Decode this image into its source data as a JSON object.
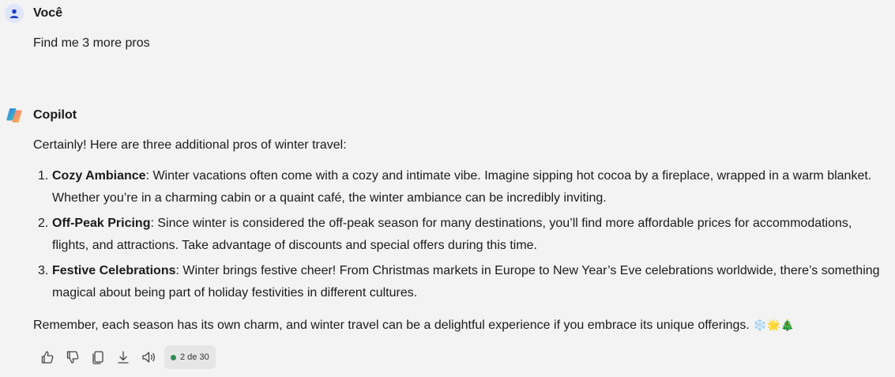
{
  "user_message": {
    "sender": "Você",
    "text": "Find me 3 more pros"
  },
  "copilot_message": {
    "sender": "Copilot",
    "intro": "Certainly! Here are three additional pros of winter travel:",
    "items": [
      {
        "number": "1.",
        "title": "Cozy Ambiance",
        "text": ": Winter vacations often come with a cozy and intimate vibe. Imagine sipping hot cocoa by a fireplace, wrapped in a warm blanket. Whether you’re in a charming cabin or a quaint café, the winter ambiance can be incredibly inviting."
      },
      {
        "number": "2.",
        "title": "Off-Peak Pricing",
        "text": ": Since winter is considered the off-peak season for many destinations, you’ll find more affordable prices for accommodations, flights, and attractions. Take advantage of discounts and special offers during this time."
      },
      {
        "number": "3.",
        "title": "Festive Celebrations",
        "text": ": Winter brings festive cheer! From Christmas markets in Europe to New Year’s Eve celebrations worldwide, there’s something magical about being part of holiday festivities in different cultures."
      }
    ],
    "outro": "Remember, each season has its own charm, and winter travel can be a delightful experience if you embrace its unique offerings. ",
    "emojis": "❄️🌟🎄"
  },
  "toolbar": {
    "counter": "2 de 30",
    "icons": [
      "thumbs-up-icon",
      "thumbs-down-icon",
      "copy-icon",
      "download-icon",
      "speaker-icon"
    ],
    "status_color": "#2e8b57"
  }
}
